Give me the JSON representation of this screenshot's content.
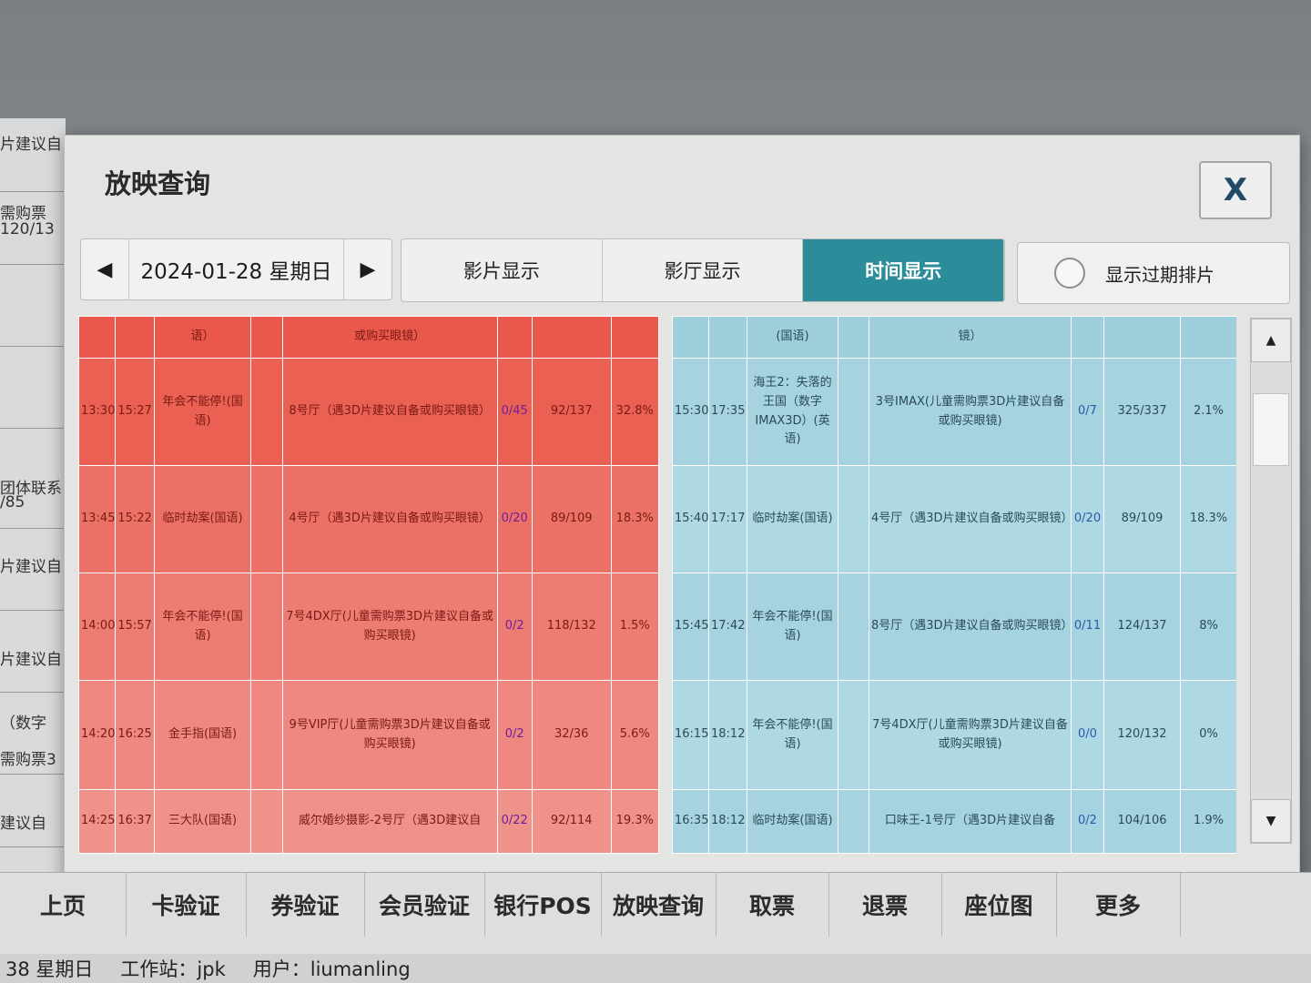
{
  "background": {
    "left_fragments": [
      "片建议自",
      "需购票",
      "120/13",
      "团体联系",
      "/85",
      "片建议自",
      "片建议自",
      "（数字",
      "需购票3",
      "建议自"
    ],
    "bottom_nav": [
      "上页",
      "卡验证",
      "券验证",
      "会员验证",
      "银行POS",
      "放映查询",
      "取票",
      "退票",
      "座位图",
      "更多"
    ],
    "status_bar": {
      "date_fragment": "38 星期日",
      "workstation": "工作站：jpk",
      "user": "用户：liumanling"
    }
  },
  "dialog": {
    "title": "放映查询",
    "close_label": "X",
    "date": "2024-01-28 星期日",
    "prev_arrow": "◀",
    "next_arrow": "▶",
    "tabs": [
      {
        "label": "影片显示",
        "active": false
      },
      {
        "label": "影厅显示",
        "active": false
      },
      {
        "label": "时间显示",
        "active": true
      }
    ],
    "show_expired_label": "显示过期排片",
    "left_table": {
      "rows": [
        {
          "start": "",
          "end": "",
          "film": "语）",
          "hall": "或购买眼镜）",
          "ratio": "",
          "seats": "",
          "rate": ""
        },
        {
          "start": "13:30",
          "end": "15:27",
          "film": "年会不能停!(国语)",
          "hall": "8号厅（遇3D片建议自备或购买眼镜）",
          "ratio": "0/45",
          "seats": "92/137",
          "rate": "32.8%"
        },
        {
          "start": "13:45",
          "end": "15:22",
          "film": "临时劫案(国语)",
          "hall": "4号厅（遇3D片建议自备或购买眼镜）",
          "ratio": "0/20",
          "seats": "89/109",
          "rate": "18.3%"
        },
        {
          "start": "14:00",
          "end": "15:57",
          "film": "年会不能停!(国语)",
          "hall": "7号4DX厅(儿童需购票3D片建议自备或购买眼镜)",
          "ratio": "0/2",
          "seats": "118/132",
          "rate": "1.5%"
        },
        {
          "start": "14:20",
          "end": "16:25",
          "film": "金手指(国语)",
          "hall": "9号VIP厅(儿童需购票3D片建议自备或购买眼镜)",
          "ratio": "0/2",
          "seats": "32/36",
          "rate": "5.6%"
        },
        {
          "start": "14:25",
          "end": "16:37",
          "film": "三大队(国语)",
          "hall": "威尔婚纱摄影-2号厅（遇3D建议自",
          "ratio": "0/22",
          "seats": "92/114",
          "rate": "19.3%"
        }
      ]
    },
    "right_table": {
      "rows": [
        {
          "start": "",
          "end": "",
          "film": "(国语)",
          "hall": "镜）",
          "ratio": "",
          "seats": "",
          "rate": ""
        },
        {
          "start": "15:30",
          "end": "17:35",
          "film": "海王2：失落的王国（数字IMAX3D）(英语)",
          "hall": "3号IMAX(儿童需购票3D片建议自备或购买眼镜)",
          "ratio": "0/7",
          "seats": "325/337",
          "rate": "2.1%"
        },
        {
          "start": "15:40",
          "end": "17:17",
          "film": "临时劫案(国语)",
          "hall": "4号厅（遇3D片建议自备或购买眼镜）",
          "ratio": "0/20",
          "seats": "89/109",
          "rate": "18.3%"
        },
        {
          "start": "15:45",
          "end": "17:42",
          "film": "年会不能停!(国语)",
          "hall": "8号厅（遇3D片建议自备或购买眼镜）",
          "ratio": "0/11",
          "seats": "124/137",
          "rate": "8%"
        },
        {
          "start": "16:15",
          "end": "18:12",
          "film": "年会不能停!(国语)",
          "hall": "7号4DX厅(儿童需购票3D片建议自备或购买眼镜)",
          "ratio": "0/0",
          "seats": "120/132",
          "rate": "0%"
        },
        {
          "start": "16:35",
          "end": "18:12",
          "film": "临时劫案(国语)",
          "hall": "口味王-1号厅（遇3D片建议自备",
          "ratio": "0/2",
          "seats": "104/106",
          "rate": "1.9%"
        }
      ]
    },
    "scroll_up": "▲",
    "scroll_down": "▼"
  },
  "colors": {
    "accent": "#2b8d99",
    "left_table": "#e9584a",
    "right_table": "#a6d3e0"
  }
}
